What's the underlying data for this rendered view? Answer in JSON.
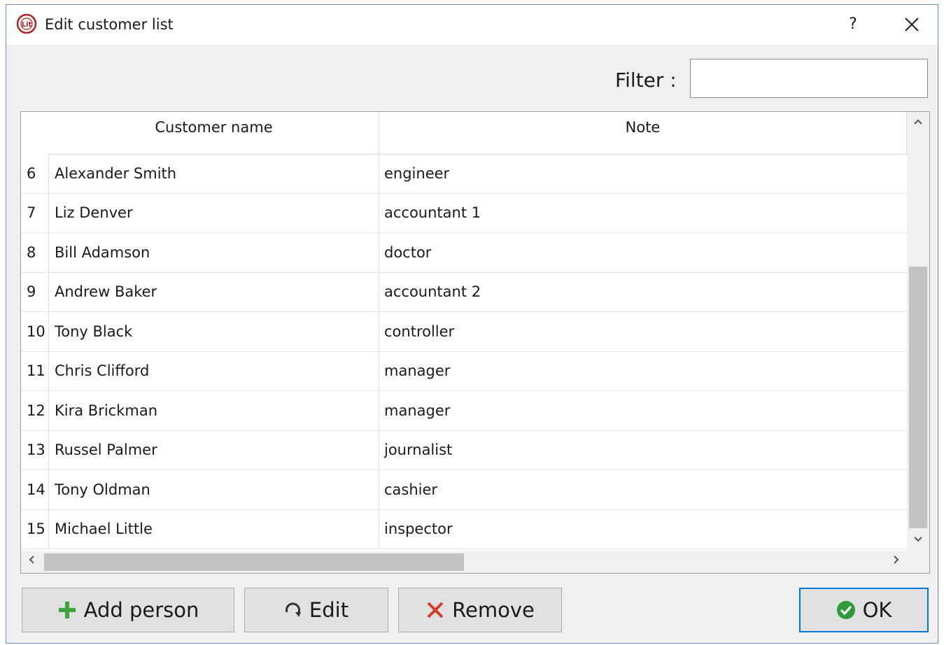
{
  "window": {
    "title": "Edit customer list",
    "help_label": "?"
  },
  "filter": {
    "label": "Filter :",
    "value": ""
  },
  "table": {
    "headers": {
      "name": "Customer name",
      "note": "Note"
    },
    "rows": [
      {
        "num": "6",
        "name": "Alexander Smith",
        "note": "engineer"
      },
      {
        "num": "7",
        "name": "Liz Denver",
        "note": "accountant 1"
      },
      {
        "num": "8",
        "name": "Bill Adamson",
        "note": "doctor"
      },
      {
        "num": "9",
        "name": "Andrew Baker",
        "note": "accountant 2"
      },
      {
        "num": "10",
        "name": "Tony Black",
        "note": "controller"
      },
      {
        "num": "11",
        "name": "Chris Clifford",
        "note": "manager"
      },
      {
        "num": "12",
        "name": "Kira Brickman",
        "note": "manager"
      },
      {
        "num": "13",
        "name": "Russel Palmer",
        "note": "journalist"
      },
      {
        "num": "14",
        "name": "Tony Oldman",
        "note": "cashier"
      },
      {
        "num": "15",
        "name": "Michael Little",
        "note": "inspector"
      }
    ]
  },
  "buttons": {
    "add": "Add person",
    "edit": "Edit",
    "remove": "Remove",
    "ok": "OK"
  },
  "icons": {
    "app": "app-logo-icon",
    "add": "plus-icon",
    "edit": "refresh-edit-icon",
    "remove": "x-icon",
    "ok": "check-circle-icon"
  },
  "colors": {
    "add_green": "#3aa53a",
    "remove_red": "#d23a2a",
    "ok_green": "#2f9a3a",
    "focus_blue": "#0078d7",
    "logo_red": "#b22222"
  }
}
